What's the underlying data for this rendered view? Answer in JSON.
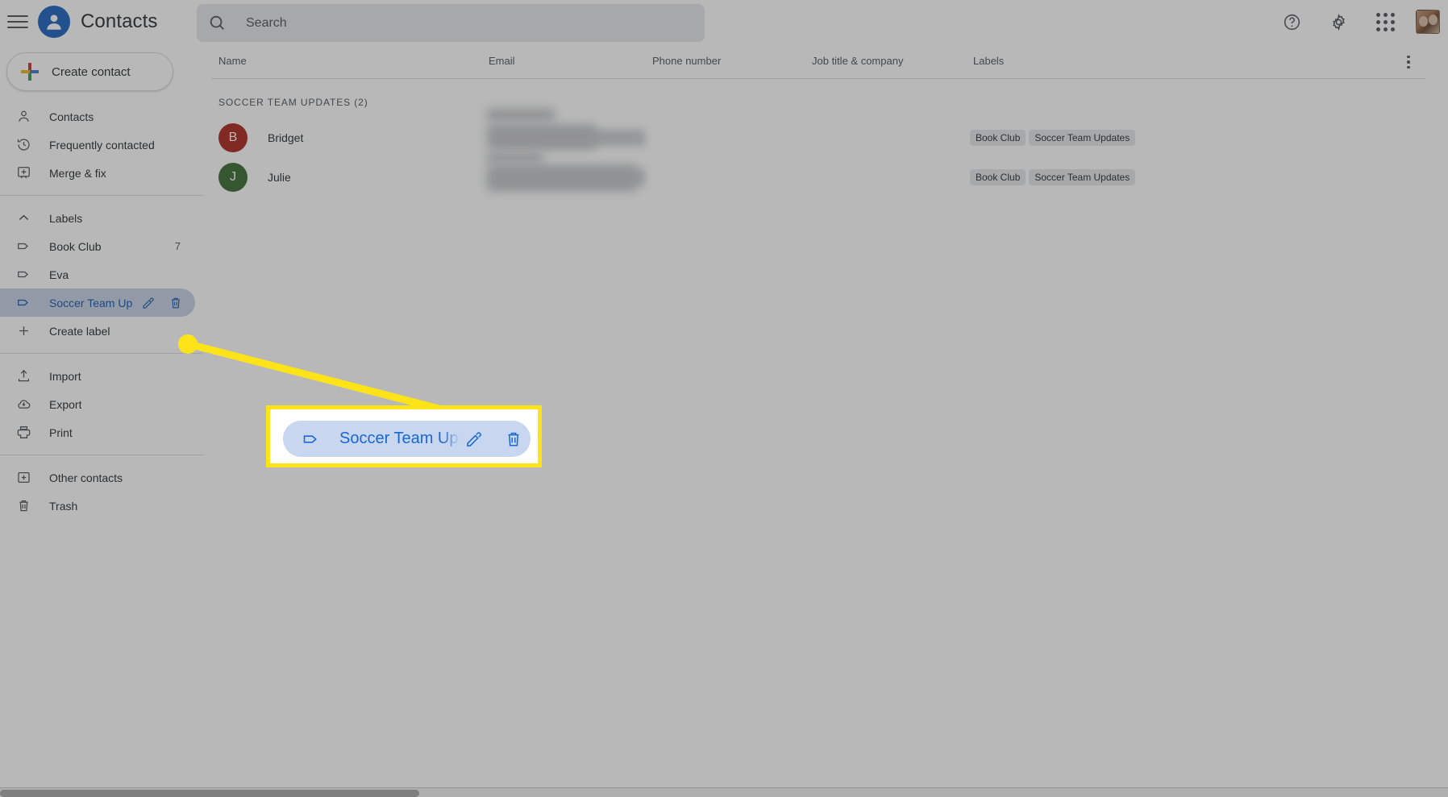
{
  "app": {
    "title": "Contacts",
    "logo_icon": "person-circle-icon",
    "menu_icon": "hamburger-menu-icon"
  },
  "search": {
    "placeholder": "Search",
    "value": "",
    "icon": "search-icon"
  },
  "topbar_actions": [
    {
      "name": "help-button",
      "icon": "help-circle-icon"
    },
    {
      "name": "settings-button",
      "icon": "gear-icon"
    },
    {
      "name": "google-apps-button",
      "icon": "apps-grid-icon"
    },
    {
      "name": "account-avatar",
      "icon": "avatar-photo"
    }
  ],
  "sidebar": {
    "create_contact": {
      "label": "Create contact",
      "icon": "plus-multicolor-icon"
    },
    "primary_items": [
      {
        "label": "Contacts",
        "icon": "person-icon",
        "count": ""
      },
      {
        "label": "Frequently contacted",
        "icon": "history-clock-icon",
        "count": ""
      },
      {
        "label": "Merge & fix",
        "icon": "merge-fix-icon",
        "count": ""
      }
    ],
    "labels_header": {
      "label": "Labels",
      "icon": "chevron-up-icon"
    },
    "labels": [
      {
        "label": "Book Club",
        "icon": "label-tag-icon",
        "count": "7",
        "selected": false
      },
      {
        "label": "Eva",
        "icon": "label-tag-icon",
        "count": "",
        "selected": false
      },
      {
        "label": "Soccer Team Updates",
        "icon": "label-tag-icon",
        "count": "",
        "selected": true
      }
    ],
    "create_label": {
      "label": "Create label",
      "icon": "plus-icon"
    },
    "tools": [
      {
        "label": "Import",
        "icon": "import-upload-icon"
      },
      {
        "label": "Export",
        "icon": "export-cloud-download-icon"
      },
      {
        "label": "Print",
        "icon": "printer-icon"
      }
    ],
    "footer_items": [
      {
        "label": "Other contacts",
        "icon": "other-contacts-icon"
      },
      {
        "label": "Trash",
        "icon": "trash-icon"
      }
    ]
  },
  "main": {
    "columns": [
      "Name",
      "Email",
      "Phone number",
      "Job title & company",
      "Labels"
    ],
    "more_options_icon": "more-vertical-icon",
    "group_title": "SOCCER TEAM UPDATES (2)",
    "rows": [
      {
        "initial": "B",
        "avatar_color": "#d93025",
        "name": "Bridget",
        "email": "",
        "phone": "",
        "job": "",
        "labels": [
          "Book Club",
          "Soccer Team Updates"
        ]
      },
      {
        "initial": "J",
        "avatar_color": "#3d7d34",
        "name": "Julie",
        "email": "",
        "phone": "",
        "job": "",
        "labels": [
          "Book Club",
          "Soccer Team Updates"
        ]
      }
    ]
  },
  "callout": {
    "label": "Soccer Team Updates",
    "tag_icon": "label-tag-icon",
    "edit_icon": "pencil-edit-icon",
    "delete_icon": "trash-delete-icon",
    "highlight_color": "#ffe319",
    "accent_color": "#1967d2",
    "chip_background": "#c8d6f0"
  }
}
